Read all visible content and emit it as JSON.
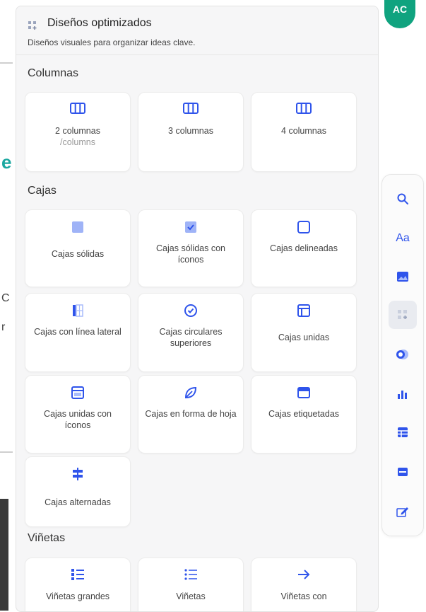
{
  "colors": {
    "accent": "#2f54eb",
    "avatar": "#10a37f",
    "panel": "#f6f6f7"
  },
  "avatar": {
    "initials": "AC"
  },
  "background_fragments": [
    "e",
    "C",
    "r"
  ],
  "panel": {
    "title": "Diseños optimizados",
    "subtitle": "Diseños visuales para organizar ideas clave.",
    "sections": {
      "columns": {
        "heading": "Columnas",
        "items": [
          {
            "label": "2 columnas",
            "sublabel": "/columns",
            "icon": "columns-icon"
          },
          {
            "label": "3 columnas",
            "icon": "columns-icon"
          },
          {
            "label": "4 columnas",
            "icon": "columns-icon"
          }
        ]
      },
      "boxes": {
        "heading": "Cajas",
        "items": [
          {
            "label": "Cajas sólidas",
            "icon": "solid-box-icon"
          },
          {
            "label": "Cajas sólidas con íconos",
            "icon": "solid-box-check-icon"
          },
          {
            "label": "Cajas delineadas",
            "icon": "outlined-box-icon"
          },
          {
            "label": "Cajas con línea lateral",
            "icon": "side-line-box-icon"
          },
          {
            "label": "Cajas circulares superiores",
            "icon": "circle-check-icon"
          },
          {
            "label": "Cajas unidas",
            "icon": "joined-box-icon"
          },
          {
            "label": "Cajas unidas con íconos",
            "icon": "joined-box-icons-icon"
          },
          {
            "label": "Cajas en forma de hoja",
            "icon": "leaf-icon"
          },
          {
            "label": "Cajas etiquetadas",
            "icon": "labeled-box-icon"
          },
          {
            "label": "Cajas alternadas",
            "icon": "alternating-box-icon"
          }
        ]
      },
      "bullets": {
        "heading": "Viñetas",
        "items": [
          {
            "label": "Viñetas grandes",
            "icon": "large-bullets-icon"
          },
          {
            "label": "Viñetas",
            "icon": "small-bullets-icon"
          },
          {
            "label": "Viñetas con",
            "icon": "arrow-right-icon"
          }
        ]
      }
    }
  },
  "toolrail": {
    "tools": [
      {
        "name": "search-tool",
        "icon": "search-icon"
      },
      {
        "name": "text-tool",
        "icon": "text-icon",
        "label": "Aa"
      },
      {
        "name": "image-tool",
        "icon": "image-icon"
      },
      {
        "name": "layouts-tool",
        "icon": "layout-grid-icon",
        "active": true
      },
      {
        "name": "toggle-tool",
        "icon": "toggle-icon"
      },
      {
        "name": "chart-tool",
        "icon": "bar-chart-icon"
      },
      {
        "name": "table-tool",
        "icon": "table-icon"
      },
      {
        "name": "banner-tool",
        "icon": "banner-icon"
      },
      {
        "name": "edit-tool",
        "icon": "edit-icon"
      }
    ]
  }
}
